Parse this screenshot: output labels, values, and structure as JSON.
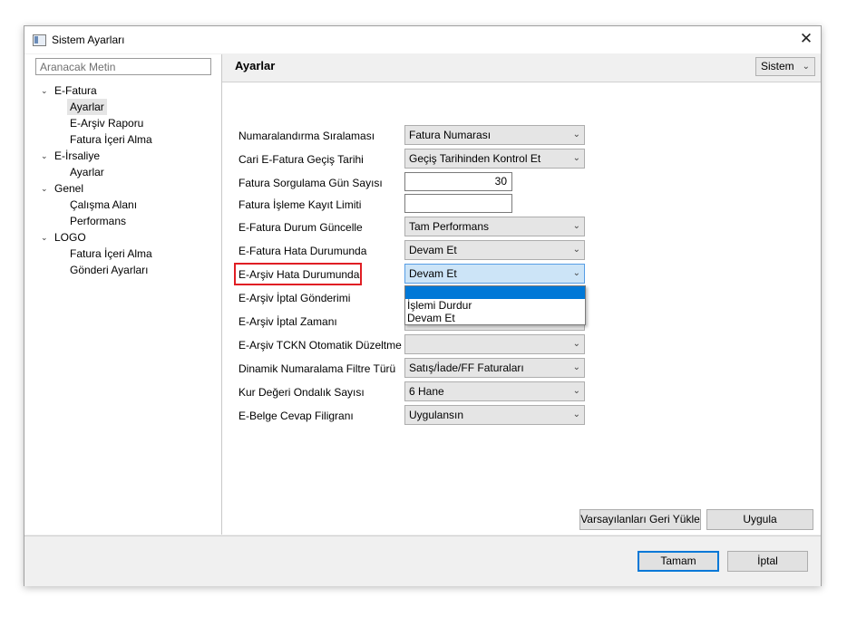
{
  "window": {
    "title": "Sistem Ayarları"
  },
  "search": {
    "placeholder": "Aranacak Metin"
  },
  "tree": {
    "groups": [
      {
        "label": "E-Fatura",
        "children": [
          "Ayarlar",
          "E-Arşiv Raporu",
          "Fatura İçeri Alma"
        ]
      },
      {
        "label": "E-İrsaliye",
        "children": [
          "Ayarlar"
        ]
      },
      {
        "label": "Genel",
        "children": [
          "Çalışma Alanı",
          "Performans"
        ]
      },
      {
        "label": "LOGO",
        "children": [
          "Fatura İçeri Alma",
          "Gönderi Ayarları"
        ]
      }
    ]
  },
  "header": {
    "title": "Ayarlar",
    "scope_value": "Sistem"
  },
  "settings": [
    {
      "label": "Numaralandırma Sıralaması",
      "value": "Fatura Numarası"
    },
    {
      "label": "Cari E-Fatura Geçiş Tarihi",
      "value": "Geçiş Tarihinden Kontrol Et"
    },
    {
      "label": "Fatura Sorgulama Gün Sayısı",
      "value": "30"
    },
    {
      "label": "Fatura İşleme Kayıt Limiti",
      "value": ""
    },
    {
      "label": "E-Fatura Durum Güncelle",
      "value": "Tam Performans"
    },
    {
      "label": "E-Fatura Hata Durumunda",
      "value": "Devam Et"
    },
    {
      "label": "E-Arşiv Hata Durumunda",
      "value": "Devam Et"
    },
    {
      "label": "E-Arşiv İptal Gönderimi",
      "value": ""
    },
    {
      "label": "E-Arşiv İptal Zamanı",
      "value": ""
    },
    {
      "label": "E-Arşiv TCKN Otomatik Düzeltme",
      "value": ""
    },
    {
      "label": "Dinamik Numaralama Filtre Türü",
      "value": "Satış/İade/FF Faturaları"
    },
    {
      "label": "Kur Değeri Ondalık Sayısı",
      "value": "6 Hane"
    },
    {
      "label": "E-Belge Cevap Filigranı",
      "value": "Uygulansın"
    }
  ],
  "dropdown_options": [
    "",
    "İşlemi Durdur",
    "Devam Et"
  ],
  "buttons": {
    "reset": "Varsayılanları Geri Yükle",
    "apply": "Uygula",
    "ok": "Tamam",
    "cancel": "İptal"
  },
  "colors": {
    "highlight_border": "#e01e24",
    "selection_blue": "#0078d7",
    "active_combo": "#cce4f7"
  }
}
